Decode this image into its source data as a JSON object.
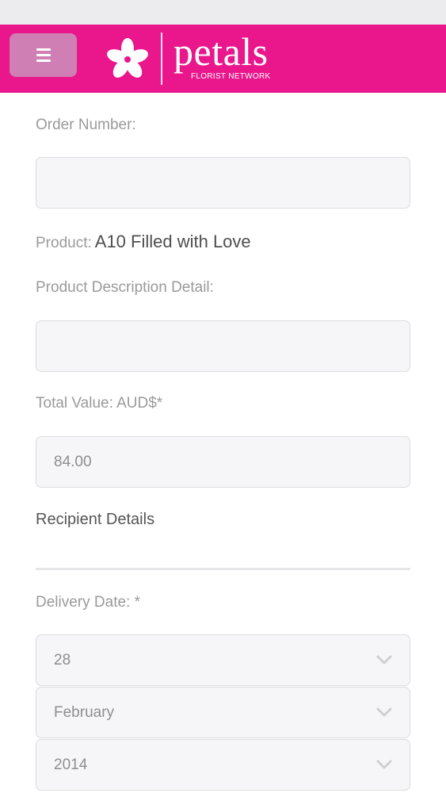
{
  "header": {
    "brand_name": "petals",
    "brand_tagline": "FLORIST NETWORK",
    "brand_color": "#e9168c",
    "menu_icon": "hamburger-menu-icon"
  },
  "form": {
    "order_number_label": "Order Number:",
    "order_number_value": "",
    "product_label": "Product:",
    "product_value": "A10 Filled with Love",
    "product_description_label": "Product Description Detail:",
    "product_description_value": "",
    "total_value_label": "Total Value: AUD$*",
    "total_value_value": "84.00",
    "recipient_section_title": "Recipient Details",
    "delivery_date_label": "Delivery Date: *",
    "delivery_day": "28",
    "delivery_month": "February",
    "delivery_year": "2014"
  }
}
